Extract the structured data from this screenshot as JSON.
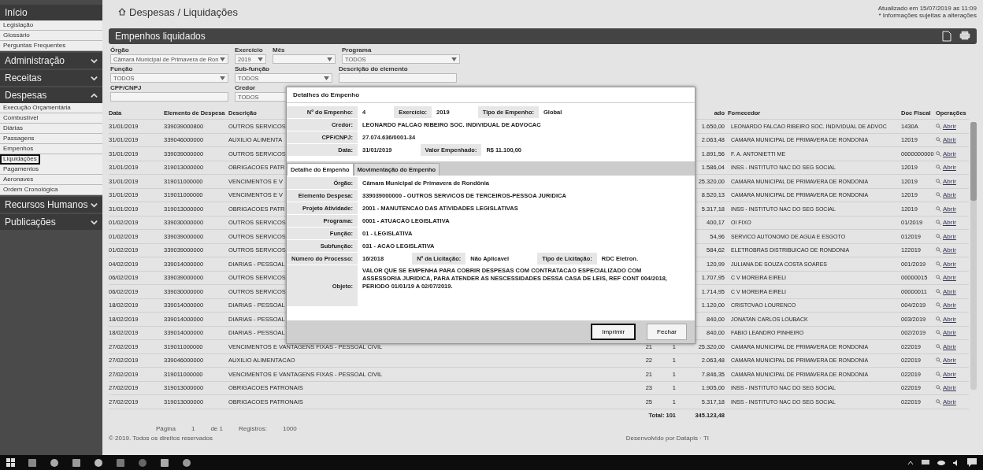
{
  "sidebar": {
    "sections": [
      {
        "label": "Início",
        "items": [
          {
            "label": "Legislação",
            "selected": false
          },
          {
            "label": "Glossário",
            "selected": false
          },
          {
            "label": "Perguntas Frequentes",
            "selected": false
          }
        ]
      },
      {
        "label": "Administração",
        "expanded": false
      },
      {
        "label": "Receitas",
        "expanded": false
      },
      {
        "label": "Despesas",
        "expanded": true,
        "items": [
          {
            "label": "Execução Orçamentária",
            "selected": false
          },
          {
            "label": "Combustível",
            "selected": false
          },
          {
            "label": "Diárias",
            "selected": false
          },
          {
            "label": "Passagens",
            "selected": false
          },
          {
            "label": "Empenhos",
            "selected": false
          },
          {
            "label": "Liquidações",
            "selected": true
          },
          {
            "label": "Pagamentos",
            "selected": false
          },
          {
            "label": "Aeronaves",
            "selected": false
          },
          {
            "label": "Ordem Cronológica",
            "selected": false
          }
        ]
      },
      {
        "label": "Recursos Humanos",
        "expanded": false
      },
      {
        "label": "Publicações",
        "expanded": false
      }
    ]
  },
  "breadcrumb": "Despesas / Liquidações",
  "updated": "Atualizado em 15/07/2019 as 11:09",
  "notice": "* Informações sujeitas a alterações",
  "panel_title": "Empenhos liquidados",
  "filters": [
    [
      {
        "label": "Órgão",
        "value": "Câmara Municipal de Primavera de Ron",
        "kind": "select"
      },
      {
        "label": "Exercício",
        "value": "2019",
        "kind": "select"
      },
      {
        "label": "Mês",
        "kind": "select"
      },
      {
        "label": "Programa",
        "value": "TODOS",
        "kind": "select"
      }
    ],
    [
      {
        "label": "Função",
        "value": "TODOS",
        "kind": "select"
      },
      {
        "label": "Sub-função",
        "value": "TODOS",
        "kind": "select"
      },
      {
        "label": "Descrição do elemento",
        "kind": "input"
      }
    ],
    [
      {
        "label": "CPF/CNPJ",
        "kind": "input"
      },
      {
        "label": "Credor",
        "value": "TODOS",
        "kind": "select"
      }
    ]
  ],
  "table": {
    "columns": [
      "Data",
      "Elemento de Despesa",
      "Descrição",
      "",
      "",
      "ado",
      "Fornecedor",
      "Doc Fiscal",
      "Operações"
    ],
    "rows": [
      {
        "date": "31/01/2019",
        "element": "339039000800",
        "desc": "OUTROS SERVICOS",
        "value": "1.650,00",
        "supplier": "LEONARDO FALCAO RIBEIRO SOC. INDIVIDUAL DE ADVOC",
        "doc": "1430A",
        "action": "Abrir"
      },
      {
        "date": "31/01/2019",
        "element": "339046000000",
        "desc": "AUXILIO ALIMENTA",
        "value": "2.063,48",
        "supplier": "CAMARA MUNICIPAL DE PRIMAVERA DE RONDONIA",
        "doc": "12019",
        "action": "Abrir"
      },
      {
        "date": "31/01/2019",
        "element": "339039000000",
        "desc": "OUTROS SERVICOS",
        "value": "1.891,56",
        "supplier": "F. A. ANTONIETTI ME",
        "doc": "0000000000",
        "action": "Abrir"
      },
      {
        "date": "31/01/2019",
        "element": "319013000000",
        "desc": "OBRIGACOES PATR",
        "value": "1.586,04",
        "supplier": "INSS - INSTITUTO NAC DO SEG SOCIAL",
        "doc": "12019",
        "action": "Abrir"
      },
      {
        "date": "31/01/2019",
        "element": "319011000000",
        "desc": "VENCIMENTOS E V",
        "value": "25.320,00",
        "supplier": "CAMARA MUNICIPAL DE PRIMAVERA DE RONDONIA",
        "doc": "12019",
        "action": "Abrir"
      },
      {
        "date": "31/01/2019",
        "element": "319011000000",
        "desc": "VENCIMENTOS E V",
        "value": "8.520,13",
        "supplier": "CAMARA MUNICIPAL DE PRIMAVERA DE RONDONIA",
        "doc": "12019",
        "action": "Abrir"
      },
      {
        "date": "31/01/2019",
        "element": "319013000000",
        "desc": "OBRIGACOES PATR",
        "value": "5.317,18",
        "supplier": "INSS - INSTITUTO NAC DO SEG SOCIAL",
        "doc": "12019",
        "action": "Abrir"
      },
      {
        "date": "01/02/2019",
        "element": "339030000000",
        "desc": "OUTROS SERVICOS",
        "value": "400,17",
        "supplier": "OI FIXO",
        "doc": "01/2019",
        "action": "Abrir"
      },
      {
        "date": "01/02/2019",
        "element": "339039000000",
        "desc": "OUTROS SERVICOS",
        "value": "54,96",
        "supplier": "SERVICO AUTONOMO DE AGUA E ESGOTO",
        "doc": "012019",
        "action": "Abrir"
      },
      {
        "date": "01/02/2019",
        "element": "339039000000",
        "desc": "OUTROS SERVICOS",
        "value": "584,62",
        "supplier": "ELETROBRAS DISTRIBUICAO DE RONDONIA",
        "doc": "122019",
        "action": "Abrir"
      },
      {
        "date": "04/02/2019",
        "element": "339014000000",
        "desc": "DIARIAS - PESSOAL",
        "value": "120,99",
        "supplier": "JULIANA DE SOUZA COSTA SOARES",
        "doc": "001/2019",
        "action": "Abrir"
      },
      {
        "date": "06/02/2019",
        "element": "339039000000",
        "desc": "OUTROS SERVICOS",
        "value": "1.707,95",
        "supplier": "C V MOREIRA EIRELI",
        "doc": "00000015",
        "action": "Abrir"
      },
      {
        "date": "06/02/2019",
        "element": "339030000000",
        "desc": "OUTROS SERVICOS",
        "value": "1.714,95",
        "supplier": "C V MOREIRA EIRELI",
        "doc": "00000011",
        "action": "Abrir"
      },
      {
        "date": "18/02/2019",
        "element": "339014000000",
        "desc": "DIARIAS - PESSOAL",
        "value": "1.120,00",
        "supplier": "CRISTOVAO LOURENCO",
        "doc": "004/2019",
        "action": "Abrir"
      },
      {
        "date": "18/02/2019",
        "element": "339014000000",
        "desc": "DIARIAS - PESSOAL",
        "value": "840,00",
        "supplier": "JONATAN CARLOS LOUBACK",
        "doc": "003/2019",
        "action": "Abrir"
      },
      {
        "date": "18/02/2019",
        "element": "339014000000",
        "desc": "DIARIAS - PESSOAL",
        "value": "840,00",
        "supplier": "FABIO LEANDRO PINHEIRO",
        "doc": "002/2019",
        "action": "Abrir"
      },
      {
        "date": "27/02/2019",
        "element": "319011000000",
        "desc": "VENCIMENTOS E VANTAGENS FIXAS - PESSOAL CIVIL",
        "column_4": "21",
        "column_5": "1",
        "value": "25.320,00",
        "supplier": "CAMARA MUNICIPAL DE PRIMAVERA DE RONDONIA",
        "doc": "022019",
        "action": "Abrir"
      },
      {
        "date": "27/02/2019",
        "element": "339046000000",
        "desc": "AUXILIO ALIMENTACAO",
        "column_4": "22",
        "column_5": "1",
        "value": "2.063,48",
        "supplier": "CAMARA MUNICIPAL DE PRIMAVERA DE RONDONIA",
        "doc": "022019",
        "action": "Abrir"
      },
      {
        "date": "27/02/2019",
        "element": "319011000000",
        "desc": "VENCIMENTOS E VANTAGENS FIXAS - PESSOAL CIVIL",
        "column_4": "21",
        "column_5": "1",
        "value": "7.846,35",
        "supplier": "CAMARA MUNICIPAL DE PRIMAVERA DE RONDONIA",
        "doc": "022019",
        "action": "Abrir"
      },
      {
        "date": "27/02/2019",
        "element": "319013000000",
        "desc": "OBRIGACOES PATRONAIS",
        "column_4": "23",
        "column_5": "1",
        "value": "1.905,00",
        "supplier": "INSS - INSTITUTO NAC DO SEG SOCIAL",
        "doc": "022019",
        "action": "Abrir"
      },
      {
        "date": "27/02/2019",
        "element": "319013000000",
        "desc": "OBRIGACOES PATRONAIS",
        "column_4": "25",
        "column_5": "1",
        "value": "5.317,18",
        "supplier": "INSS - INSTITUTO NAC DO SEG SOCIAL",
        "doc": "022019",
        "action": "Abrir"
      }
    ],
    "total_label": "Total: 101",
    "total_value": "345.123,48"
  },
  "pagination": {
    "page_label": "Página",
    "page": "1",
    "of": "de 1",
    "records_label": "Registros:",
    "records": "1000"
  },
  "copyright": "© 2019. Todos os direitos reservados",
  "developer": "Desenvolvido por Datapis · TI",
  "modal": {
    "title": "Detalhes do Empenho",
    "header_rows": [
      [
        {
          "label": "Nº do Empenho:",
          "value": "4"
        },
        {
          "label": "Exercício:",
          "value": "2019"
        },
        {
          "label": "Tipo de Empenho:",
          "value": "Global"
        }
      ],
      [
        {
          "label": "Credor:",
          "value": "LEONARDO FALCAO RIBEIRO SOC. INDIVIDUAL DE ADVOCAC"
        }
      ],
      [
        {
          "label": "CPF/CNPJ:",
          "value": "27.074.636/0001-34"
        }
      ],
      [
        {
          "label": "Data:",
          "value": "31/01/2019"
        },
        {
          "label": "Valor Empenhado:",
          "value": "R$ 11.100,00"
        }
      ]
    ],
    "tabs": [
      {
        "label": "Detalhe do Empenho",
        "selected": true
      },
      {
        "label": "Movimentação do Empenho",
        "selected": false
      }
    ],
    "detail_rows": [
      [
        {
          "label": "Órgão:",
          "value": "Câmara Municipal de Primavera de Rondônia"
        }
      ],
      [
        {
          "label": "Elemento Despesa:",
          "value": "339039000000 - OUTROS SERVICOS DE TERCEIROS-PESSOA JURIDICA"
        }
      ],
      [
        {
          "label": "Projeto Atividade:",
          "value": "2001 - MANUTENCAO DAS ATIVIDADES LEGISLATIVAS"
        }
      ],
      [
        {
          "label": "Programa:",
          "value": "0001 - ATUACAO LEGISLATIVA"
        }
      ],
      [
        {
          "label": "Função:",
          "value": "01 - LEGISLATIVA"
        }
      ],
      [
        {
          "label": "Subfunção:",
          "value": "031 - ACAO LEGISLATIVA"
        }
      ],
      [
        {
          "label": "Número do Processo:",
          "value": "16/2018"
        },
        {
          "label": "Nº da Licitação:",
          "value": "Não Aplicavel"
        },
        {
          "label": "Tipo de Licitação:",
          "value": "RDC Eletron."
        }
      ],
      [
        {
          "label": "Objeto:",
          "value": "VALOR QUE SE EMPENHA PARA COBRIR DESPESAS COM CONTRATACAO ESPECIALIZADO COM ASSESSORIA JURIDICA, PARA ATENDER AS NESCESSIDADES DESSA CASA DE LEIS, REF CONT 004/2018, PERIODO 01/01/19 A 02/07/2019."
        }
      ]
    ],
    "buttons": [
      {
        "label": "Imprimir",
        "focused": true
      },
      {
        "label": "Fechar",
        "focused": false
      }
    ]
  }
}
